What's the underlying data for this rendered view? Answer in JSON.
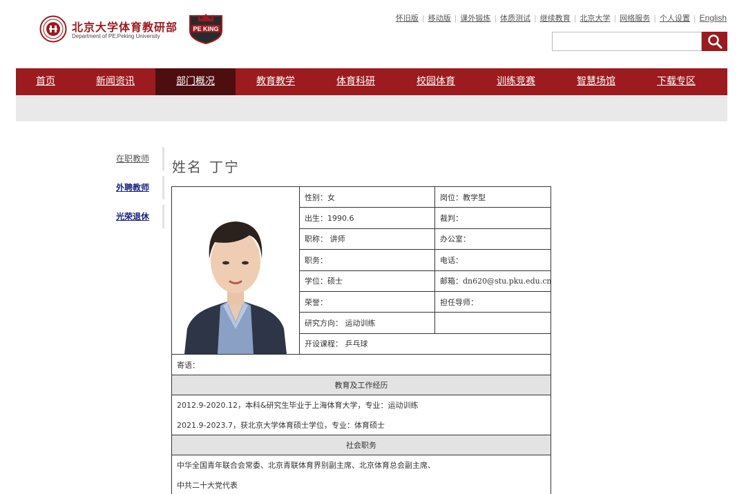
{
  "header": {
    "site_name": "北京大学体育教研部",
    "site_name_en": "Department of PE,Peking University",
    "team_logo_text": "PE KING",
    "top_links": [
      "怀旧版",
      "移动版",
      "课外锻炼",
      "体质测试",
      "继续教育",
      "北京大学",
      "网络服务",
      "个人设置",
      "English"
    ],
    "search_value": ""
  },
  "nav": {
    "items": [
      "首页",
      "新闻资讯",
      "部门概况",
      "教育教学",
      "体育科研",
      "校园体育",
      "训练竞赛",
      "智慧场馆",
      "下载专区"
    ],
    "active": "部门概况"
  },
  "side_menu": {
    "items": [
      "在职教师",
      "外聘教师",
      "光荣退休"
    ]
  },
  "profile": {
    "name_label": "姓名",
    "name_value": "丁宁",
    "gender_label": "性别：",
    "gender_value": "女",
    "post_label": "岗位：",
    "post_value": "教学型",
    "birth_label": "出生：",
    "birth_value": "1990.6",
    "referee_label": "裁判：",
    "referee_value": "",
    "title_label": "职称：",
    "title_value": "讲师",
    "office_label": "办公室：",
    "office_value": "",
    "duty_label": "职务：",
    "duty_value": "",
    "phone_label": "电话：",
    "phone_value": "",
    "degree_label": "学位：",
    "degree_value": "硕士",
    "email_label": "邮箱：",
    "email_value": "dn620@stu.pku.edu.cn",
    "honor_label": "荣誉：",
    "honor_value": "",
    "supervisor_label": "担任导师：",
    "supervisor_value": "",
    "research_label": "研究方向：",
    "research_value": "运动训练",
    "course_label": "开设课程：",
    "course_value": "乒乓球",
    "motto_label": "寄语：",
    "motto_value": ""
  },
  "sections": {
    "education_title": "教育及工作经历",
    "education_lines": [
      "2012.9-2020.12，本科&研究生毕业于上海体育大学，专业：运动训练",
      "2021.9-2023.7，获北京大学体育硕士学位，专业：体育硕士"
    ],
    "social_title": "社会职务",
    "social_lines": [
      "中华全国青年联合会常委、北京青联体育界别副主席、北京体育总会副主席、",
      "中共二十大党代表"
    ]
  },
  "colors": {
    "brand_red": "#9b1b1f",
    "nav_active": "#4e0d0f",
    "subnav_gray": "#e9e9e9"
  }
}
